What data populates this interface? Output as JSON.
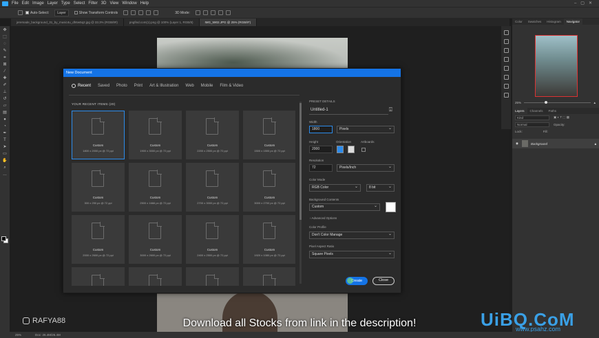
{
  "menubar": {
    "items": [
      "File",
      "Edit",
      "Image",
      "Layer",
      "Type",
      "Select",
      "Filter",
      "3D",
      "View",
      "Window",
      "Help"
    ]
  },
  "options": {
    "auto_select": "Auto-Select:",
    "layer_select": "Layer",
    "show_transform": "Show Transform Controls",
    "mode_3d": "3D Mode:"
  },
  "tabs": [
    {
      "label": "jeremade_background_31_by_music4u_dh6w5q2.jpg @ 33.3% (RGB/8#)"
    },
    {
      "label": "pngfind.com(1).png @ 100% (Layer 1, RGB/8)"
    },
    {
      "label": "IMG_5902.JPG @ 25% (RGB/8*)"
    }
  ],
  "status": {
    "zoom": "25%",
    "doc": "Doc: 26.4M/26.4M"
  },
  "caption": "Download all Stocks from link in the description!",
  "channel": "RAFYA88",
  "watermark": {
    "brand": "UiBQ.CoM",
    "sub": "www.psahz.com"
  },
  "panels": {
    "top_tabs": [
      "Color",
      "Swatches",
      "Histogram",
      "Navigator"
    ],
    "nav_zoom": "25%",
    "layer_tabs": [
      "Layers",
      "Channels",
      "Paths"
    ],
    "kind": "Kind",
    "blend": "Normal",
    "opacity": "Opacity:",
    "lock": "Lock:",
    "fill": "Fill:",
    "layer_name": "Background"
  },
  "dialog": {
    "title": "New Document",
    "nav": [
      "Recent",
      "Saved",
      "Photo",
      "Print",
      "Art & Illustration",
      "Web",
      "Mobile",
      "Film & Video"
    ],
    "recent_title": "YOUR RECENT ITEMS  (20)",
    "items": [
      {
        "name": "Custom",
        "dims": "1800 x 2000 px @ 72 ppi"
      },
      {
        "name": "Custom",
        "dims": "1900 x 3000 px @ 72 ppi"
      },
      {
        "name": "Custom",
        "dims": "2200 x 2500 px @ 72 ppi"
      },
      {
        "name": "Custom",
        "dims": "1500 x 1500 px @ 72 ppi"
      },
      {
        "name": "Custom",
        "dims": "300 x 250 px @ 72 ppi"
      },
      {
        "name": "Custom",
        "dims": "2500 x 1666 px @ 72 ppi"
      },
      {
        "name": "Custom",
        "dims": "2700 x 3000 px @ 72 ppi"
      },
      {
        "name": "Custom",
        "dims": "3000 x 2700 px @ 72 ppi"
      },
      {
        "name": "Custom",
        "dims": "2000 x 2600 px @ 72 ppi"
      },
      {
        "name": "Custom",
        "dims": "3000 x 2600 px @ 72 ppi"
      },
      {
        "name": "Custom",
        "dims": "2400 x 2500 px @ 72 ppi"
      },
      {
        "name": "Custom",
        "dims": "1920 x 1080 px @ 72 ppi"
      },
      {
        "name": "",
        "dims": ""
      },
      {
        "name": "",
        "dims": ""
      },
      {
        "name": "",
        "dims": ""
      },
      {
        "name": "",
        "dims": ""
      }
    ],
    "details": {
      "header": "PRESET DETAILS",
      "name": "Untitled-1",
      "width_label": "Width",
      "width_value": "1800",
      "width_unit": "Pixels",
      "height_label": "Height",
      "height_value": "2000",
      "orientation_label": "Orientation",
      "artboards_label": "Artboards",
      "resolution_label": "Resolution",
      "resolution_value": "72",
      "resolution_unit": "Pixels/Inch",
      "color_mode_label": "Color Mode",
      "color_mode": "RGB Color",
      "bit_depth": "8 bit",
      "bg_label": "Background Contents",
      "bg_value": "Custom",
      "advanced": "Advanced Options",
      "profile_label": "Color Profile",
      "profile_value": "Don't Color Manage",
      "aspect_label": "Pixel Aspect Ratio",
      "aspect_value": "Square Pixels"
    },
    "create": "Create",
    "close": "Close"
  },
  "colors": {
    "accent": "#1473e6",
    "selection": "#2d8ceb"
  }
}
